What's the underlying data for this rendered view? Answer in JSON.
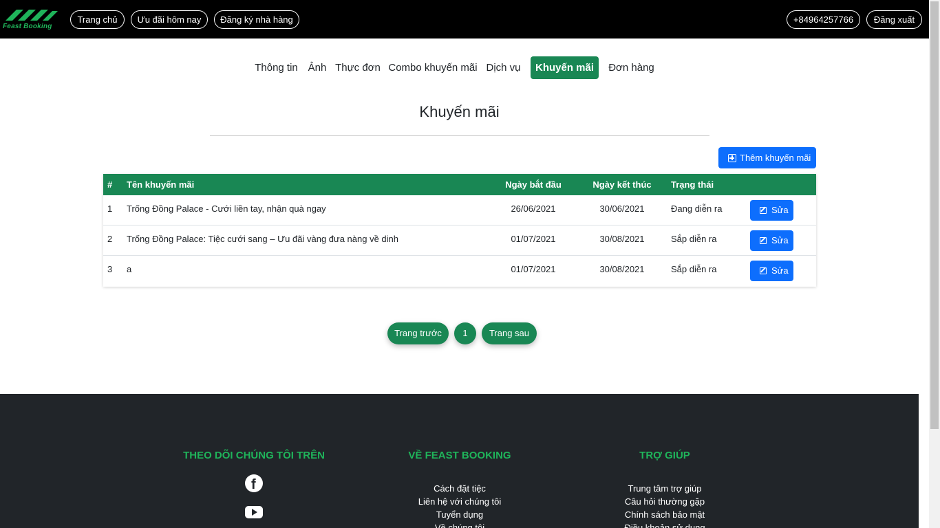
{
  "brand": {
    "logo_text": "Feast Booking"
  },
  "topnav": {
    "home": "Trang chủ",
    "deals_today": "Ưu đãi hôm nay",
    "register_restaurant": "Đăng ký nhà hàng",
    "phone": "+84964257766",
    "logout": "Đăng xuất"
  },
  "subnav": {
    "items": [
      "Thông tin",
      "Ảnh",
      "Thực đơn",
      "Combo khuyến mãi",
      "Dịch vụ",
      "Khuyến mãi",
      "Đơn hàng"
    ],
    "active": "Khuyến mãi"
  },
  "page": {
    "title": "Khuyến mãi",
    "add_button": "Thêm khuyến mãi"
  },
  "table": {
    "headers": [
      "#",
      "Tên khuyến mãi",
      "Ngày bắt đầu",
      "Ngày kết thúc",
      "Trạng thái"
    ],
    "rows": [
      {
        "idx": "1",
        "name": "Trống Đồng Palace - Cưới liền tay, nhận quà ngay",
        "start": "26/06/2021",
        "end": "30/06/2021",
        "status": "Đang diễn ra",
        "action": "Sửa"
      },
      {
        "idx": "2",
        "name": "Trống Đồng Palace: Tiệc cưới sang – Ưu đãi vàng đưa nàng về dinh",
        "start": "01/07/2021",
        "end": "30/08/2021",
        "status": "Sắp diễn ra",
        "action": "Sửa"
      },
      {
        "idx": "3",
        "name": "a",
        "start": "01/07/2021",
        "end": "30/08/2021",
        "status": "Sắp diễn ra",
        "action": "Sửa"
      }
    ]
  },
  "pagination": {
    "prev": "Trang trước",
    "current": "1",
    "next": "Trang sau"
  },
  "footer": {
    "follow_title": "THEO DÕI CHÚNG TÔI TRÊN",
    "about_title": "VỀ FEAST BOOKING",
    "about_links": [
      "Cách đặt tiệc",
      "Liên hệ với chúng tôi",
      "Tuyển dụng",
      "Về chúng tôi"
    ],
    "help_title": "TRỢ GIÚP",
    "help_links": [
      "Trung tâm trợ giúp",
      "Câu hỏi thường gặp",
      "Chính sách bảo mật",
      "Điều khoản sử dụng"
    ],
    "social_icons": [
      "facebook-icon",
      "youtube-icon"
    ]
  },
  "colors": {
    "navbar": "#000000",
    "accent_green": "#198754",
    "primary_blue": "#0d6efd",
    "footer": "#212529",
    "footer_heading": "#1fb45a"
  }
}
